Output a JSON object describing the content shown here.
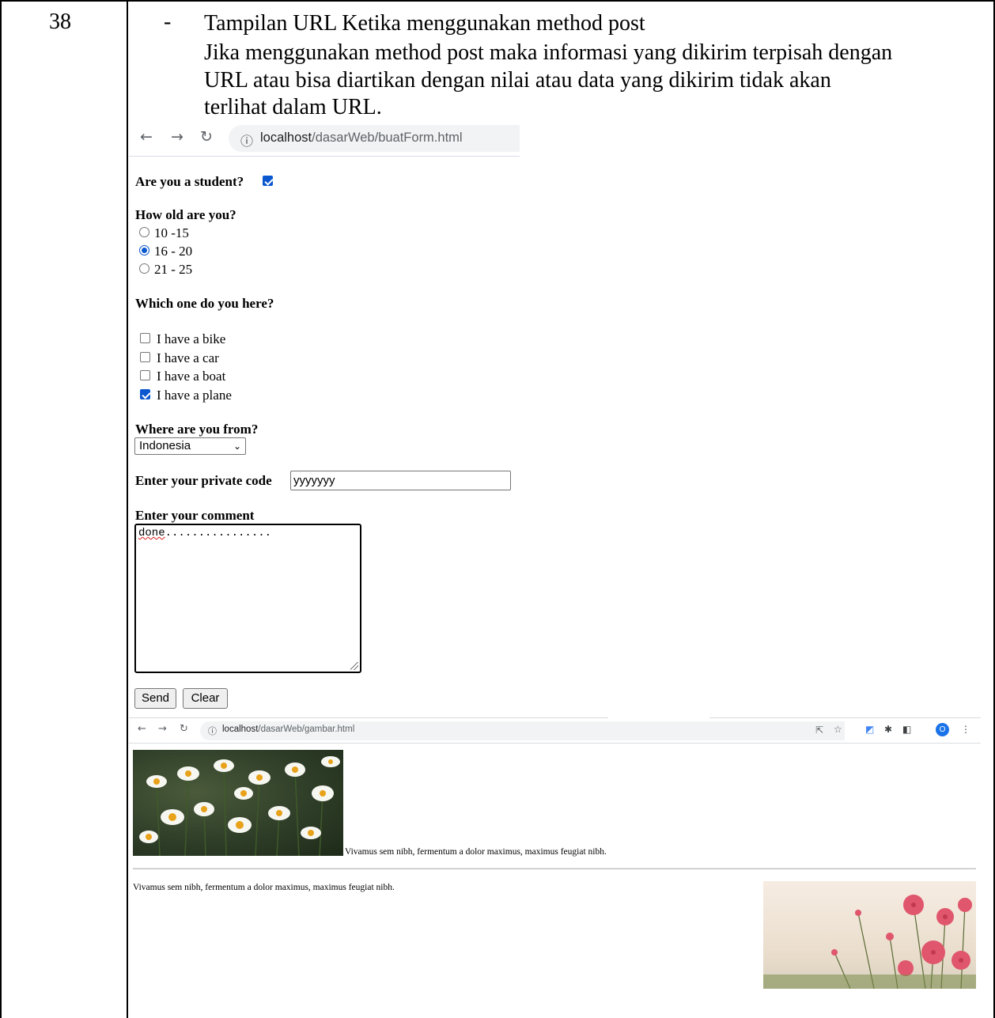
{
  "row": {
    "number": "38",
    "bullet": "-",
    "lines": [
      "Tampilan URL Ketika menggunakan method post",
      "Jika menggunakan method post maka informasi yang dikirim terpisah dengan",
      "URL atau bisa diartikan dengan nilai atau data yang dikirim tidak akan",
      "terlihat dalam URL."
    ]
  },
  "browser1": {
    "url_host": "localhost",
    "url_path": "/dasarWeb/buatForm.html"
  },
  "form": {
    "student_label": "Are you a student?",
    "student_checked": true,
    "age_label": "How old are you?",
    "age_options": [
      "10 -15",
      "16 - 20",
      "21 - 25"
    ],
    "age_selected_index": 1,
    "vehicle_label": "Which one do you here?",
    "vehicle_options": [
      "I have a bike",
      "I have a car",
      "I have a boat",
      "I have a plane"
    ],
    "vehicle_checked": [
      false,
      false,
      false,
      true
    ],
    "country_label": "Where are you from?",
    "country_value": "Indonesia",
    "code_label": "Enter your private code",
    "code_value": "yyyyyyy",
    "comment_label": "Enter your comment",
    "comment_word": "done",
    "comment_dots": "................",
    "send_label": "Send",
    "clear_label": "Clear"
  },
  "browser2": {
    "url_host": "localhost",
    "url_path": "/dasarWeb/gambar.html",
    "profile_initial": "O",
    "icons": [
      "share-icon",
      "star-icon",
      "translate-icon",
      "extensions-icon",
      "side-panel-icon",
      "menu-icon"
    ]
  },
  "page2": {
    "caption_right": "Vivamus sem nibh, fermentum a dolor maximus, maximus feugiat nibh.",
    "caption_left": "Vivamus sem nibh, fermentum a dolor maximus, maximus feugiat nibh."
  },
  "colors": {
    "accent": "#0b57d0",
    "toolbar_pill": "#f1f3f4",
    "profile": "#1a73e8",
    "spellcheck": "#e02020"
  }
}
